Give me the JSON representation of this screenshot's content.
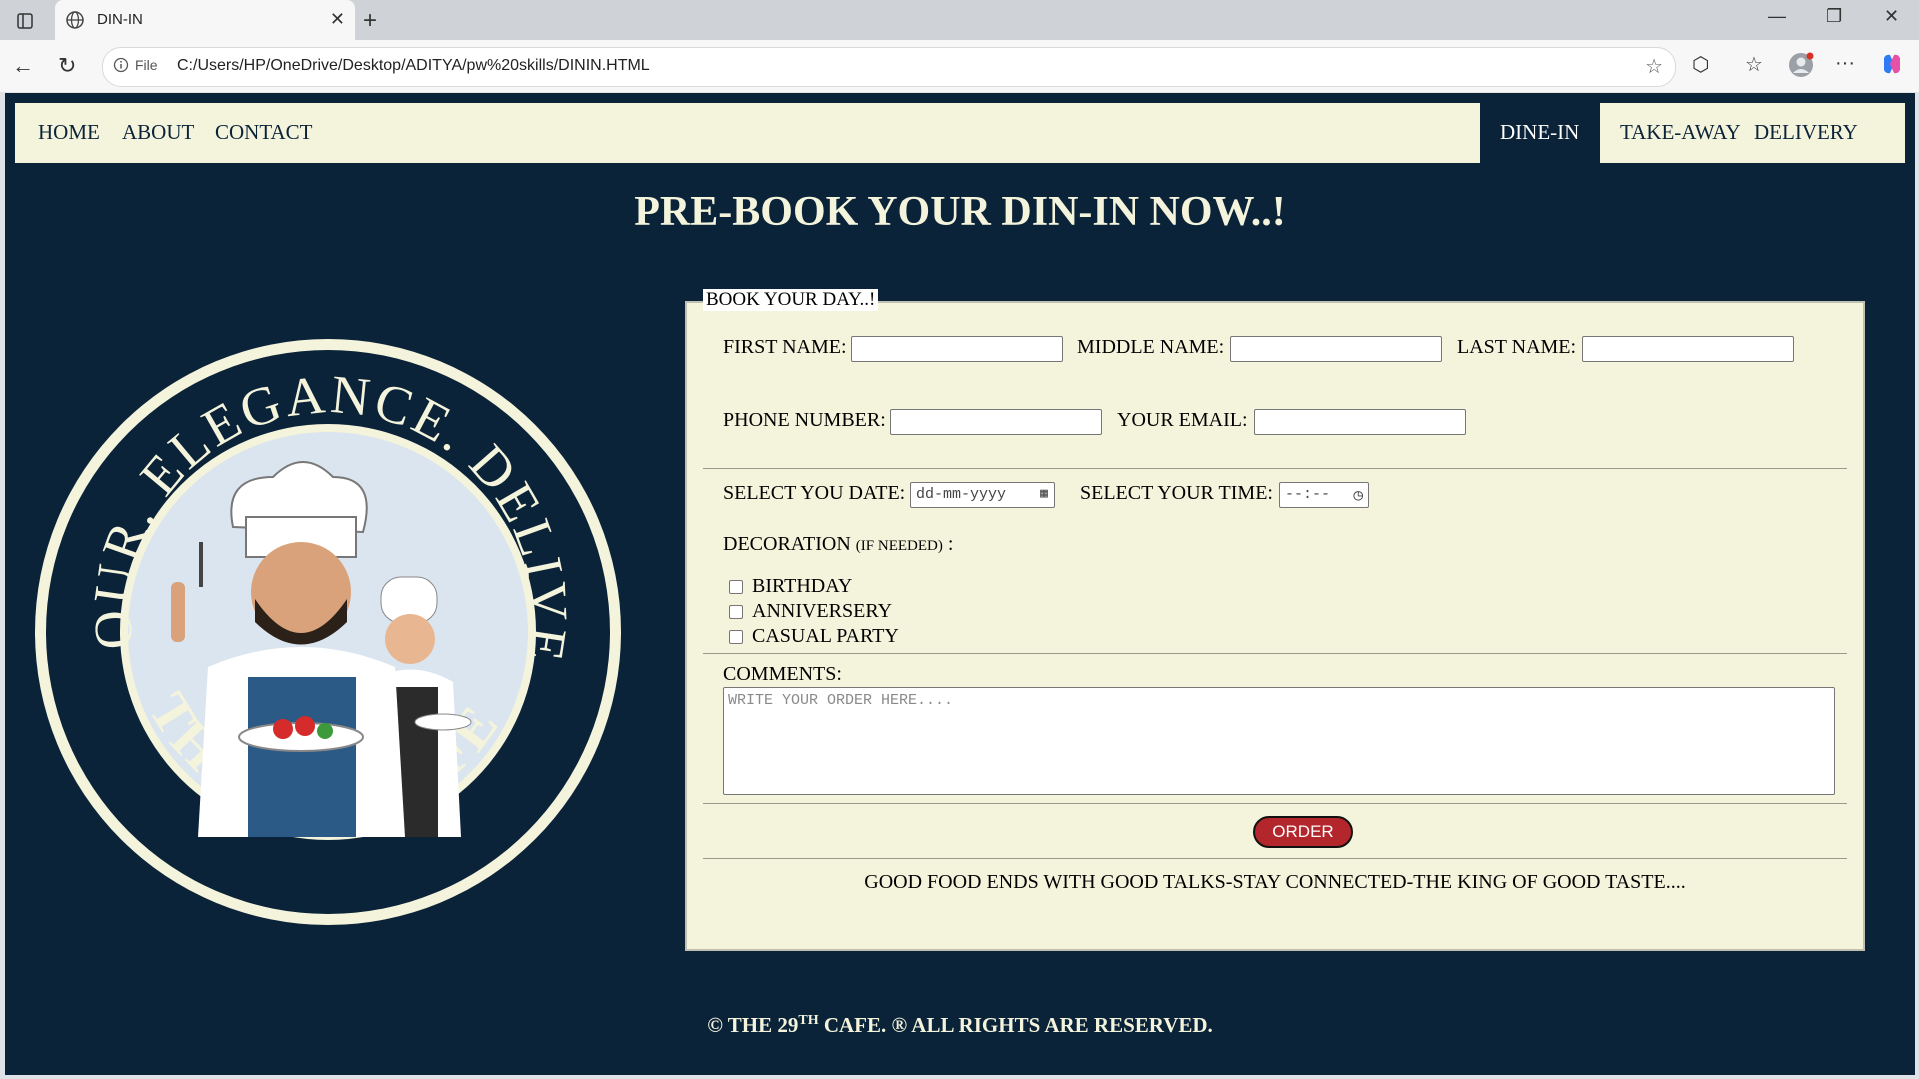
{
  "browser": {
    "tab_title": "DIN-IN",
    "url_chip": "File",
    "url": "C:/Users/HP/OneDrive/Desktop/ADITYA/pw%20skills/DININ.HTML"
  },
  "nav": {
    "left": [
      "HOME",
      "ABOUT",
      "CONTACT"
    ],
    "right": [
      "DINE-IN",
      "TAKE-AWAY",
      "DELIVERY"
    ]
  },
  "page": {
    "heading": "PRE-BOOK YOUR DIN-IN NOW..!"
  },
  "logo": {
    "top_arc": "FLAVOUR. ELEGANCE. DELIVERED.",
    "bottom_arc": "THE 29th CAFE."
  },
  "form": {
    "legend": "BOOK YOUR DAY..!",
    "first_name_label": "FIRST NAME:",
    "middle_name_label": "MIDDLE NAME:",
    "last_name_label": "LAST NAME:",
    "phone_label": "PHONE NUMBER:",
    "email_label": "YOUR EMAIL:",
    "date_label": "SELECT YOU DATE:",
    "date_placeholder": "dd-mm-yyyy",
    "time_label": "SELECT YOUR TIME:",
    "time_placeholder": "--:--",
    "decoration_label": "DECORATION",
    "decoration_note": "(IF NEEDED)",
    "decoration_colon": ":",
    "decoration_options": [
      "BIRTHDAY",
      "ANNIVERSERY",
      "CASUAL PARTY"
    ],
    "comments_label": "COMMENTS:",
    "comments_placeholder": "WRITE YOUR ORDER HERE....",
    "order_button": "ORDER",
    "tagline": "GOOD FOOD ENDS WITH GOOD TALKS-STAY CONNECTED-THE KING OF GOOD TASTE...."
  },
  "footer": {
    "prefix": "© THE 29",
    "sup": "TH",
    "suffix": " CAFE. ® ALL RIGHTS ARE RESERVED."
  },
  "colors": {
    "page_bg": "#0b2339",
    "cream": "#f4f3dc",
    "order_red": "#b3262c"
  }
}
